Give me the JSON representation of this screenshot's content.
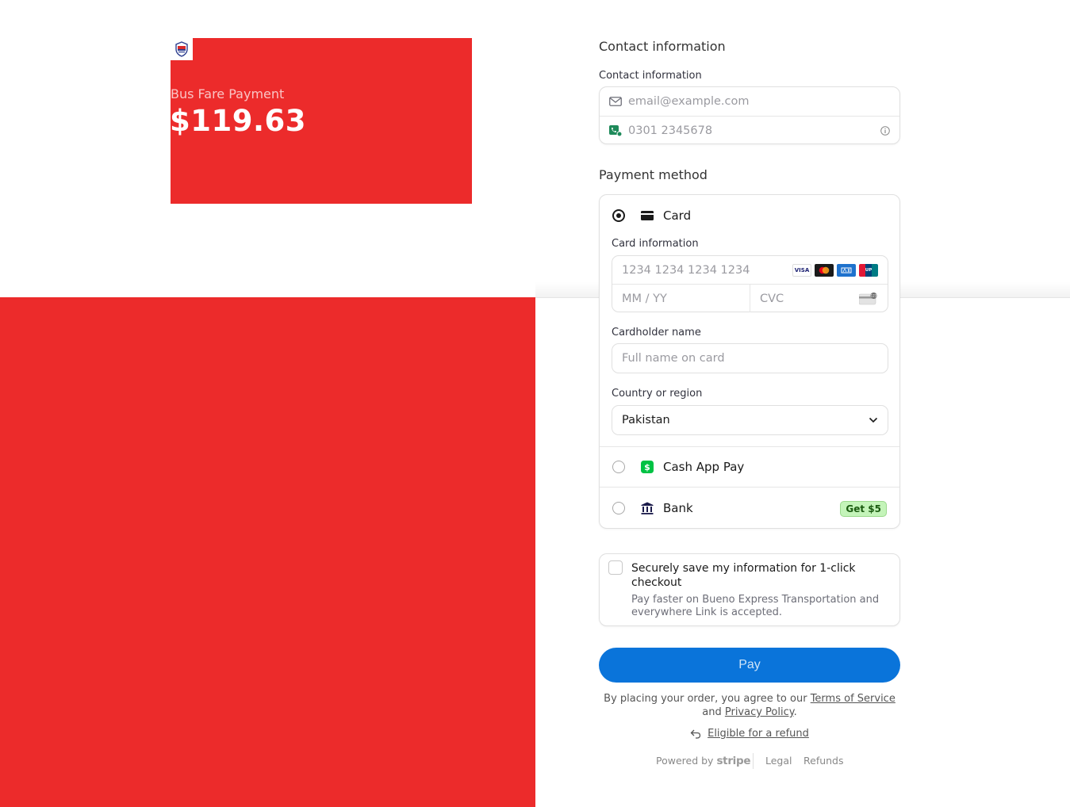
{
  "product": {
    "name": "Bus Fare Payment",
    "amount": "$119.63"
  },
  "contact": {
    "section_title": "Contact information",
    "label": "Contact information",
    "email_placeholder": "email@example.com",
    "phone_placeholder": "0301 2345678"
  },
  "payment": {
    "section_title": "Payment method",
    "card": {
      "label": "Card",
      "selected": true,
      "card_info_label": "Card information",
      "number_placeholder": "1234 1234 1234 1234",
      "expiry_placeholder": "MM / YY",
      "cvc_placeholder": "CVC",
      "brands": [
        "visa",
        "mastercard",
        "amex",
        "unionpay"
      ],
      "cardholder_label": "Cardholder name",
      "cardholder_placeholder": "Full name on card",
      "country_label": "Country or region",
      "country_value": "Pakistan"
    },
    "cashapp": {
      "label": "Cash App Pay",
      "selected": false
    },
    "bank": {
      "label": "Bank",
      "selected": false,
      "badge": "Get $5"
    }
  },
  "link": {
    "title": "Securely save my information for 1-click checkout",
    "description": "Pay faster on Bueno Express Transportation and everywhere Link is accepted."
  },
  "pay_button": "Pay",
  "terms": {
    "prefix": "By placing your order, you agree to our",
    "terms_link": "Terms of Service",
    "and": "and",
    "privacy_link": "Privacy Policy",
    "suffix": "."
  },
  "refund_link": "Eligible for a refund",
  "footer": {
    "powered_by": "Powered by",
    "stripe": "stripe",
    "legal": "Legal",
    "refunds": "Refunds"
  },
  "colors": {
    "brand_red": "#ec2b2b",
    "pay_button": "#0a74da",
    "cashapp_green": "#00c244",
    "bank_badge_bg": "#c4f4b9"
  }
}
